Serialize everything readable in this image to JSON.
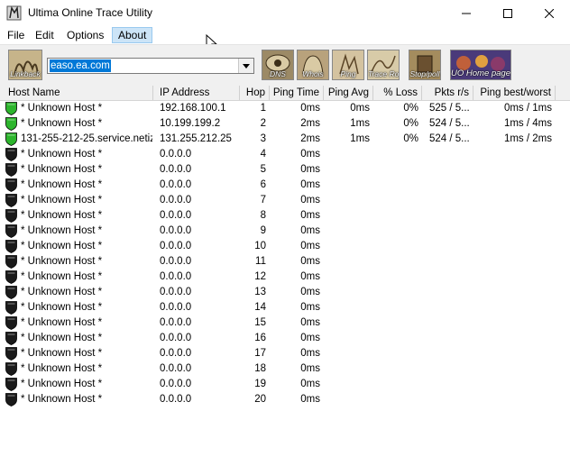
{
  "window": {
    "title": "Ultima Online Trace Utility"
  },
  "menu": {
    "items": [
      "File",
      "Edit",
      "Options",
      "About"
    ]
  },
  "toolbar": {
    "buttons": [
      "Linkback",
      "DNS",
      "Whois",
      "Ping",
      "Trace Route",
      "Stop/poll",
      "UO Home page"
    ],
    "host_value": "easo.ea.com"
  },
  "table": {
    "columns": [
      "Host Name",
      "IP Address",
      "Hop",
      "Ping Time",
      "Ping Avg",
      "% Loss",
      "Pkts r/s",
      "Ping best/worst"
    ],
    "rows": [
      {
        "status": "ok",
        "host": "* Unknown Host *",
        "ip": "192.168.100.1",
        "hop": "1",
        "time": "0ms",
        "avg": "0ms",
        "loss": "0%",
        "pkts": "525 / 5...",
        "best": "0ms / 1ms"
      },
      {
        "status": "ok",
        "host": "* Unknown Host *",
        "ip": "10.199.199.2",
        "hop": "2",
        "time": "2ms",
        "avg": "1ms",
        "loss": "0%",
        "pkts": "524 / 5...",
        "best": "1ms / 4ms"
      },
      {
        "status": "ok",
        "host": "131-255-212-25.service.netiz...",
        "ip": "131.255.212.25",
        "hop": "3",
        "time": "2ms",
        "avg": "1ms",
        "loss": "0%",
        "pkts": "524 / 5...",
        "best": "1ms / 2ms"
      },
      {
        "status": "none",
        "host": "* Unknown Host *",
        "ip": "0.0.0.0",
        "hop": "4",
        "time": "0ms",
        "avg": "",
        "loss": "",
        "pkts": "",
        "best": ""
      },
      {
        "status": "none",
        "host": "* Unknown Host *",
        "ip": "0.0.0.0",
        "hop": "5",
        "time": "0ms",
        "avg": "",
        "loss": "",
        "pkts": "",
        "best": ""
      },
      {
        "status": "none",
        "host": "* Unknown Host *",
        "ip": "0.0.0.0",
        "hop": "6",
        "time": "0ms",
        "avg": "",
        "loss": "",
        "pkts": "",
        "best": ""
      },
      {
        "status": "none",
        "host": "* Unknown Host *",
        "ip": "0.0.0.0",
        "hop": "7",
        "time": "0ms",
        "avg": "",
        "loss": "",
        "pkts": "",
        "best": ""
      },
      {
        "status": "none",
        "host": "* Unknown Host *",
        "ip": "0.0.0.0",
        "hop": "8",
        "time": "0ms",
        "avg": "",
        "loss": "",
        "pkts": "",
        "best": ""
      },
      {
        "status": "none",
        "host": "* Unknown Host *",
        "ip": "0.0.0.0",
        "hop": "9",
        "time": "0ms",
        "avg": "",
        "loss": "",
        "pkts": "",
        "best": ""
      },
      {
        "status": "none",
        "host": "* Unknown Host *",
        "ip": "0.0.0.0",
        "hop": "10",
        "time": "0ms",
        "avg": "",
        "loss": "",
        "pkts": "",
        "best": ""
      },
      {
        "status": "none",
        "host": "* Unknown Host *",
        "ip": "0.0.0.0",
        "hop": "11",
        "time": "0ms",
        "avg": "",
        "loss": "",
        "pkts": "",
        "best": ""
      },
      {
        "status": "none",
        "host": "* Unknown Host *",
        "ip": "0.0.0.0",
        "hop": "12",
        "time": "0ms",
        "avg": "",
        "loss": "",
        "pkts": "",
        "best": ""
      },
      {
        "status": "none",
        "host": "* Unknown Host *",
        "ip": "0.0.0.0",
        "hop": "13",
        "time": "0ms",
        "avg": "",
        "loss": "",
        "pkts": "",
        "best": ""
      },
      {
        "status": "none",
        "host": "* Unknown Host *",
        "ip": "0.0.0.0",
        "hop": "14",
        "time": "0ms",
        "avg": "",
        "loss": "",
        "pkts": "",
        "best": ""
      },
      {
        "status": "none",
        "host": "* Unknown Host *",
        "ip": "0.0.0.0",
        "hop": "15",
        "time": "0ms",
        "avg": "",
        "loss": "",
        "pkts": "",
        "best": ""
      },
      {
        "status": "none",
        "host": "* Unknown Host *",
        "ip": "0.0.0.0",
        "hop": "16",
        "time": "0ms",
        "avg": "",
        "loss": "",
        "pkts": "",
        "best": ""
      },
      {
        "status": "none",
        "host": "* Unknown Host *",
        "ip": "0.0.0.0",
        "hop": "17",
        "time": "0ms",
        "avg": "",
        "loss": "",
        "pkts": "",
        "best": ""
      },
      {
        "status": "none",
        "host": "* Unknown Host *",
        "ip": "0.0.0.0",
        "hop": "18",
        "time": "0ms",
        "avg": "",
        "loss": "",
        "pkts": "",
        "best": ""
      },
      {
        "status": "none",
        "host": "* Unknown Host *",
        "ip": "0.0.0.0",
        "hop": "19",
        "time": "0ms",
        "avg": "",
        "loss": "",
        "pkts": "",
        "best": ""
      },
      {
        "status": "none",
        "host": "* Unknown Host *",
        "ip": "0.0.0.0",
        "hop": "20",
        "time": "0ms",
        "avg": "",
        "loss": "",
        "pkts": "",
        "best": ""
      }
    ]
  },
  "colors": {
    "ok_shield": "#2db52d",
    "none_shield": "#1a1a1a",
    "selection": "#0078d7"
  }
}
